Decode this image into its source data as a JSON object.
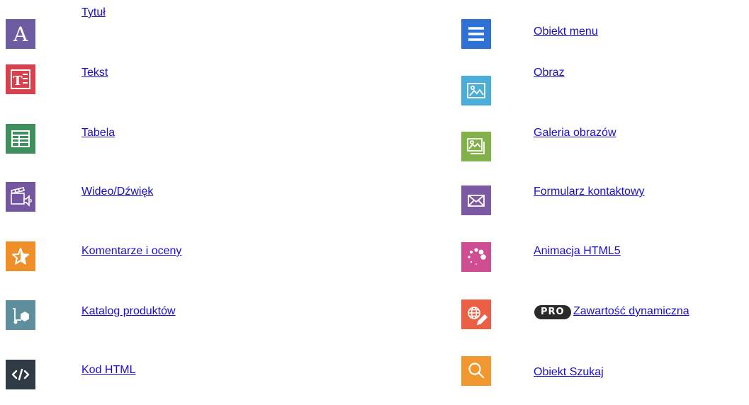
{
  "colors": {
    "link": "#1a0dcc",
    "title_tile": "#6f5ba2",
    "text_tile": "#d8404d",
    "table_tile": "#3f8f5e",
    "video_tile": "#7455a0",
    "comments_tile": "#ef8f2a",
    "catalog_tile": "#5f8e9c",
    "html_tile": "#2f3a44",
    "menu_tile": "#2d72d2",
    "image_tile": "#4aaed8",
    "gallery_tile": "#82b04a",
    "contact_tile": "#7c5aa3",
    "animation_tile": "#cf4e93",
    "dynamic_tile": "#ec5f44",
    "search_tile": "#f0982f",
    "pro_badge": "#2a2a2a"
  },
  "left": [
    {
      "label": "Tytuł",
      "icon": "letter-a-icon"
    },
    {
      "label": "Tekst",
      "icon": "text-block-icon"
    },
    {
      "label": "Tabela",
      "icon": "table-icon"
    },
    {
      "label": "Wideo/Dźwięk",
      "icon": "video-sound-icon"
    },
    {
      "label": "Komentarze i oceny",
      "icon": "star-icon"
    },
    {
      "label": "Katalog produktów",
      "icon": "cart-box-icon"
    },
    {
      "label": "Kod HTML",
      "icon": "code-icon"
    }
  ],
  "right": [
    {
      "label": "Obiekt menu",
      "icon": "hamburger-menu-icon"
    },
    {
      "label": "Obraz",
      "icon": "image-icon"
    },
    {
      "label": "Galeria obrazów",
      "icon": "gallery-icon"
    },
    {
      "label": "Formularz kontaktowy",
      "icon": "envelope-icon"
    },
    {
      "label": "Animacja HTML5",
      "icon": "spinner-icon"
    },
    {
      "label": "Zawartość dynamiczna",
      "icon": "globe-pencil-icon",
      "badge": "PRO"
    },
    {
      "label": "Obiekt Szukaj",
      "icon": "search-icon"
    }
  ]
}
